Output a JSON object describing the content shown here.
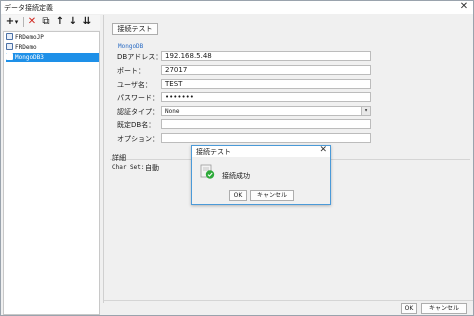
{
  "window": {
    "title": "データ接続定義",
    "close_glyph": "✕"
  },
  "toolbar": {
    "add_glyph": "+",
    "add_dropdown_glyph": "▾",
    "delete_glyph": "✕",
    "copy_glyph": "⧉",
    "up_glyph": "↑",
    "down_glyph": "↓",
    "sort_glyph": "⇊"
  },
  "tree": {
    "items": [
      {
        "label": "FRDemoJP"
      },
      {
        "label": "FRDemo"
      },
      {
        "label": "MongoDB3"
      }
    ],
    "selected_index": 2
  },
  "main": {
    "test_button_label": "接続テスト",
    "group_title": "MongoDB",
    "fields": {
      "db_address_label": "DBアドレス：",
      "db_address_value": "192.168.5.48",
      "port_label": "ポート：",
      "port_value": "27017",
      "user_label": "ユーザ名：",
      "user_value": "TEST",
      "password_label": "パスワード：",
      "password_value": "•••••••",
      "auth_type_label": "認証タイプ：",
      "auth_type_value": "None",
      "default_db_label": "既定DB名：",
      "default_db_value": "",
      "options_label": "オプション：",
      "options_value": ""
    },
    "detail": {
      "title": "詳細",
      "charset_label": "Char Set:",
      "charset_value": "自動"
    }
  },
  "footer": {
    "ok_label": "OK",
    "cancel_label": "キャンセル"
  },
  "dialog": {
    "title": "接続テスト",
    "close_glyph": "✕",
    "message": "接続成功",
    "ok_label": "OK",
    "cancel_label": "キャンセル",
    "success_color": "#2eaa3a"
  },
  "colors": {
    "accent": "#1e90e8",
    "dialog_border": "#4b9ad8"
  }
}
